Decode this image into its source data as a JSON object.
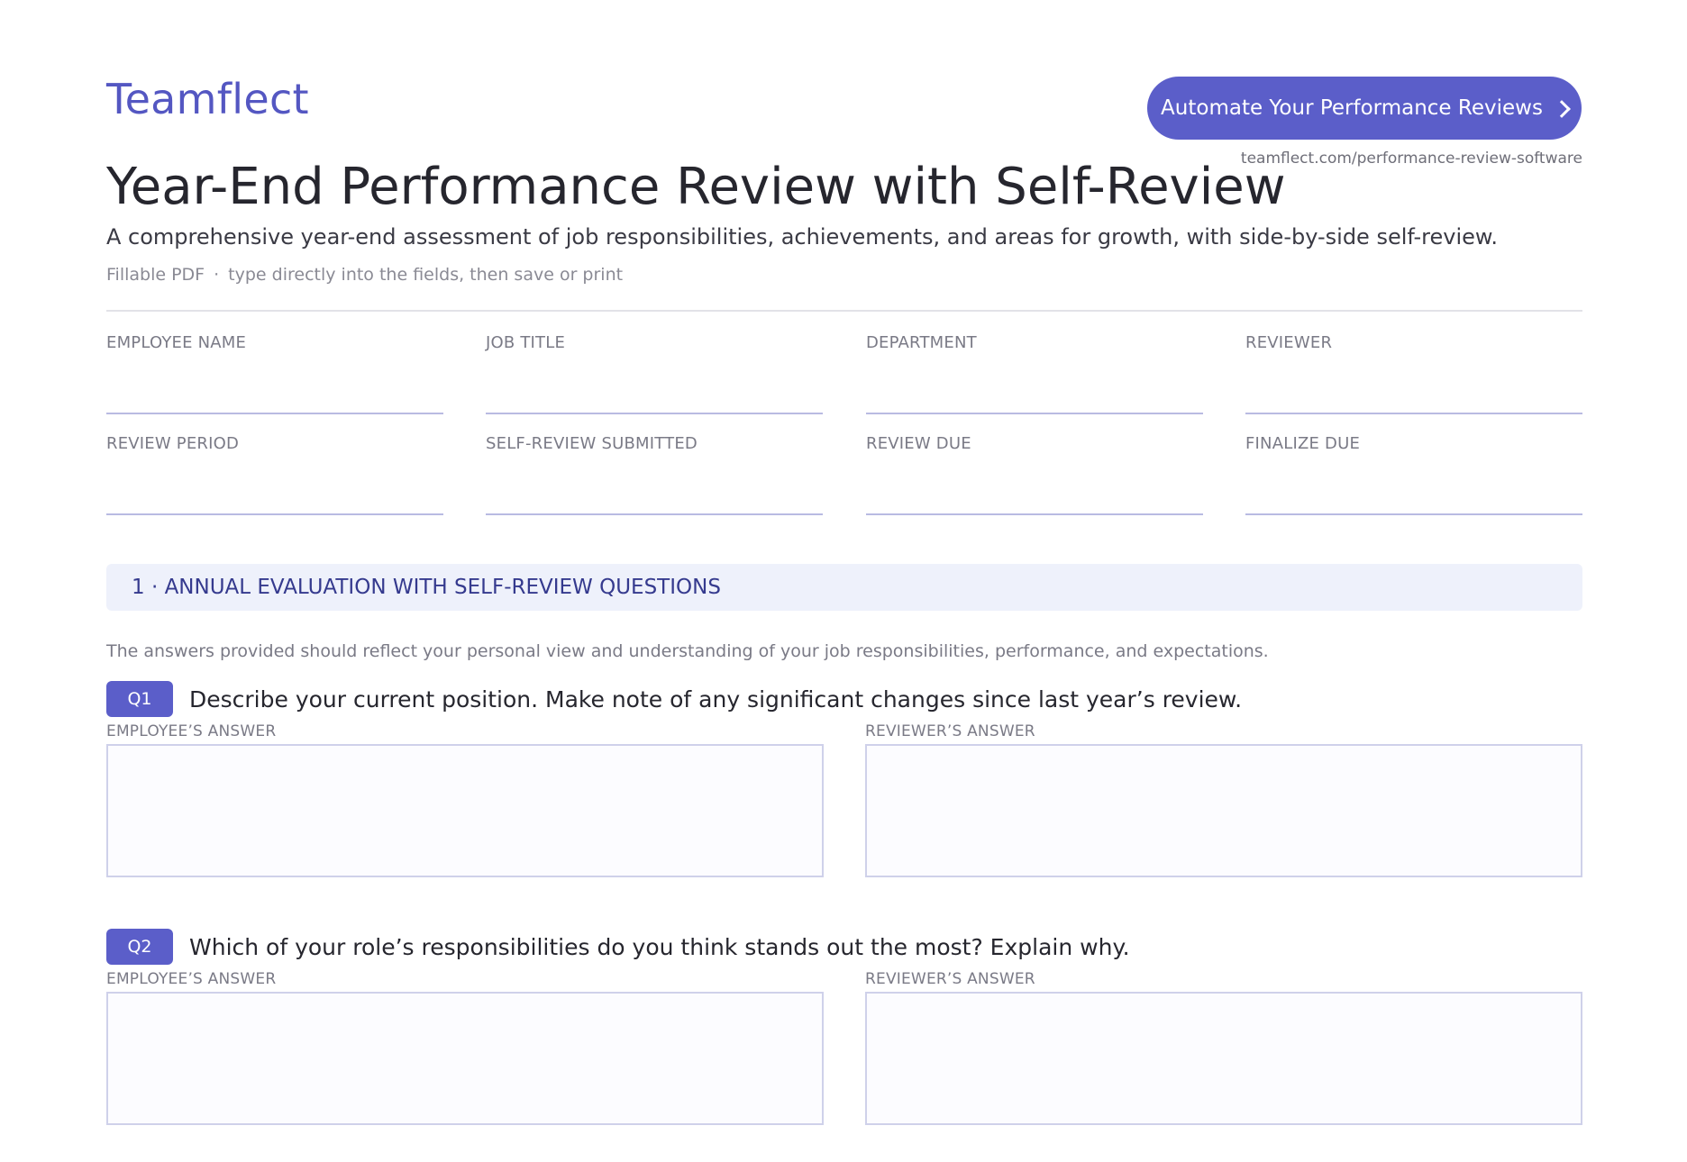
{
  "header": {
    "logo": "Teamflect",
    "cta_label": "Automate Your Performance Reviews",
    "cta_icon": "chevron-right-icon",
    "cta_url": "teamflect.com/performance-review-software"
  },
  "document": {
    "title": "Year-End Performance Review with Self-Review",
    "subtitle": "A comprehensive year-end assessment of job responsibilities, achievements, and areas for growth, with side-by-side self-review.",
    "hint_format": "Fillable PDF",
    "hint_separator": "·",
    "hint_instruction": "type directly into the fields, then save or print"
  },
  "fields": [
    {
      "label": "EMPLOYEE NAME",
      "value": ""
    },
    {
      "label": "JOB TITLE",
      "value": ""
    },
    {
      "label": "DEPARTMENT",
      "value": ""
    },
    {
      "label": "REVIEWER",
      "value": ""
    },
    {
      "label": "REVIEW PERIOD",
      "value": ""
    },
    {
      "label": "SELF-REVIEW SUBMITTED",
      "value": ""
    },
    {
      "label": "REVIEW DUE",
      "value": ""
    },
    {
      "label": "FINALIZE DUE",
      "value": ""
    }
  ],
  "section": {
    "title": "1 · ANNUAL EVALUATION WITH SELF-REVIEW QUESTIONS",
    "intro": "The answers provided should reflect your personal view and understanding of your job responsibilities, performance, and expectations."
  },
  "questions": [
    {
      "badge": "Q1",
      "text": "Describe your current position. Make note of any significant changes since last year’s review.",
      "employee_label": "EMPLOYEE’S ANSWER",
      "reviewer_label": "REVIEWER’S ANSWER",
      "employee_answer": "",
      "reviewer_answer": ""
    },
    {
      "badge": "Q2",
      "text": "Which of your role’s responsibilities do you think stands out the most? Explain why.",
      "employee_label": "EMPLOYEE’S ANSWER",
      "reviewer_label": "REVIEWER’S ANSWER",
      "employee_answer": "",
      "reviewer_answer": ""
    }
  ],
  "colors": {
    "brand": "#5457c2",
    "button": "#5b5ec9",
    "section_bg": "#eef1fb",
    "section_text": "#353a8e",
    "field_line": "#b9bbe2",
    "box_border": "#cfd1ea"
  }
}
